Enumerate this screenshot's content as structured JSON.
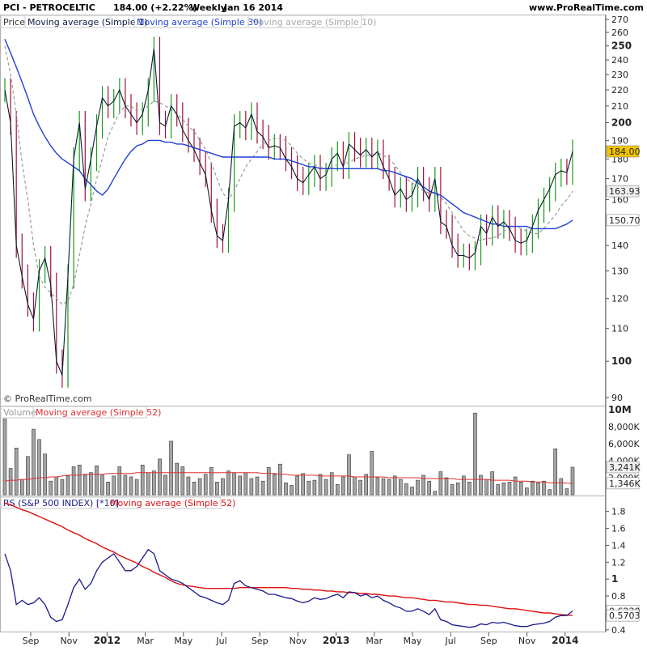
{
  "header": {
    "symbol_title": "PCI - PETROCELTIC",
    "last": "184.00 (+2.22%)",
    "period": "Weekly",
    "date": "Jan 16 2014",
    "site": "www.ProRealTime.com"
  },
  "watermark": "© ProRealTime.com",
  "colors": {
    "bull": "#1a9a1a",
    "bear": "#a0103a",
    "line": "#0a1a30",
    "ma30": "#1f3fd6",
    "ma10": "#9a9a9a",
    "volume_ma": "#e03030",
    "rs_line": "#1a1a8a",
    "rs_ma": "#e01010",
    "price_tag": "#f5c400"
  },
  "chart_data": [
    {
      "type": "line",
      "panel": "price",
      "legend": [
        "Price",
        "Moving average (Simple 1)",
        "Moving average (Simple 30)",
        "Moving average (Simple 10)"
      ],
      "y_scale": "log",
      "ylim": [
        90,
        270
      ],
      "y_ticks": [
        90,
        100,
        110,
        120,
        130,
        140,
        150,
        160,
        170,
        180,
        190,
        200,
        210,
        220,
        230,
        240,
        250,
        260,
        270
      ],
      "y_major_ticks": [
        100,
        150,
        200,
        250
      ],
      "x_ticks": [
        "Sep",
        "Nov",
        "2012",
        "Mar",
        "May",
        "Jul",
        "Sep",
        "Nov",
        "2013",
        "Mar",
        "May",
        "Jul",
        "Sep",
        "Nov",
        "2014"
      ],
      "x_major_ticks": [
        "2012",
        "2013",
        "2014"
      ],
      "price_tags": [
        {
          "label": "184.00",
          "value": 184,
          "series": "Price"
        },
        {
          "label": "163.93",
          "value": 163.93,
          "series": "Moving average (Simple 10)"
        },
        {
          "label": "150.70",
          "value": 150.7,
          "series": "Moving average (Simple 30)"
        }
      ],
      "close": [
        220,
        200,
        140,
        128,
        118,
        113,
        130,
        135,
        125,
        100,
        96,
        128,
        180,
        200,
        165,
        180,
        198,
        215,
        210,
        213,
        220,
        210,
        205,
        200,
        205,
        220,
        248,
        200,
        198,
        210,
        205,
        196,
        190,
        185,
        178,
        172,
        155,
        144,
        142,
        160,
        198,
        200,
        197,
        205,
        195,
        192,
        186,
        187,
        186,
        180,
        176,
        170,
        168,
        172,
        176,
        170,
        172,
        180,
        183,
        176,
        188,
        185,
        182,
        185,
        181,
        184,
        176,
        170,
        162,
        165,
        160,
        162,
        170,
        165,
        160,
        170,
        150,
        148,
        140,
        136,
        136,
        135,
        137,
        148,
        145,
        152,
        148,
        150,
        147,
        142,
        141,
        142,
        148,
        155,
        160,
        165,
        172,
        174,
        173,
        184
      ],
      "ma10": [
        250,
        230,
        205,
        178,
        160,
        140,
        128,
        124,
        122,
        120,
        118,
        119,
        125,
        136,
        148,
        158,
        170,
        180,
        192,
        199,
        206,
        210,
        210,
        207,
        208,
        210,
        213,
        212,
        210,
        208,
        205,
        202,
        198,
        195,
        190,
        185,
        178,
        170,
        163,
        160,
        164,
        170,
        176,
        180,
        184,
        188,
        190,
        191,
        191,
        190,
        187,
        183,
        180,
        178,
        177,
        176,
        175,
        176,
        177,
        178,
        178,
        180,
        181,
        182,
        182,
        183,
        182,
        180,
        177,
        173,
        170,
        168,
        166,
        164,
        163,
        163,
        161,
        158,
        154,
        150,
        146,
        144,
        143,
        142,
        143,
        143,
        144,
        146,
        147,
        148,
        147,
        146,
        145,
        145,
        147,
        150,
        153,
        157,
        160,
        163.93
      ],
      "ma30": [
        255,
        245,
        235,
        225,
        215,
        205,
        198,
        192,
        187,
        183,
        180,
        178,
        176,
        174,
        170,
        167,
        164,
        162,
        165,
        170,
        175,
        180,
        184,
        187,
        188,
        190,
        190,
        190,
        189,
        189,
        188,
        188,
        187,
        186,
        185,
        184,
        183,
        182,
        181,
        181,
        181,
        181,
        181,
        181,
        181,
        181,
        181,
        180,
        180,
        180,
        179,
        178,
        177,
        176,
        176,
        175,
        175,
        175,
        175,
        175,
        175,
        175,
        175,
        175,
        175,
        175,
        174,
        174,
        173,
        172,
        171,
        170,
        168,
        166,
        164,
        163,
        162,
        160,
        158,
        156,
        154,
        153,
        152,
        151,
        150,
        149,
        149,
        148,
        148,
        148,
        148,
        148,
        147,
        147,
        147,
        147,
        147,
        148,
        149,
        150.7
      ]
    },
    {
      "type": "bar",
      "panel": "volume",
      "legend": [
        "Volume",
        "Moving average (Simple 52)"
      ],
      "ylim": [
        0,
        10000000
      ],
      "y_ticks": [
        "10M",
        "8,000K",
        "6,000K",
        "4,000K",
        "2,000K"
      ],
      "tags": [
        {
          "label": "3,241K",
          "value": 3241000,
          "series": "Volume"
        },
        {
          "label": "1,346K",
          "value": 1346000,
          "series": "Moving average (Simple 52)"
        }
      ],
      "values": [
        8.9,
        3.1,
        5.5,
        1.8,
        4.5,
        7.7,
        6.5,
        4.8,
        1.6,
        2.1,
        1.8,
        2.2,
        3.3,
        3.5,
        2.3,
        2.6,
        3.4,
        2.3,
        1.5,
        2.2,
        3.3,
        2.3,
        2.1,
        1.8,
        3.5,
        2.6,
        2.8,
        4.2,
        2.3,
        6.3,
        3.7,
        3.3,
        2.1,
        1.5,
        1.9,
        2.4,
        3.2,
        1.5,
        1.9,
        2.8,
        2.6,
        2.2,
        2.6,
        1.9,
        2.1,
        1.6,
        3.2,
        2.4,
        3.6,
        1.4,
        1.1,
        2.2,
        2.5,
        1.6,
        1.7,
        2.4,
        1.8,
        2.6,
        1.2,
        2.1,
        4.7,
        2.1,
        1.7,
        2.4,
        5.1,
        2.0,
        1.9,
        1.8,
        2.2,
        1.8,
        1.3,
        0.9,
        1.7,
        2.3,
        1.6,
        0.4,
        2.7,
        2.0,
        1.2,
        1.4,
        2.2,
        1.5,
        9.6,
        2.3,
        1.8,
        2.7,
        1.2,
        1.4,
        1.5,
        2.1,
        1.5,
        0.8,
        1.6,
        1.4,
        1.6,
        0.6,
        5.4,
        1.9,
        0.7,
        3.241
      ],
      "ma52": [
        1.6,
        1.7,
        1.7,
        1.8,
        1.8,
        1.9,
        2.0,
        2.0,
        2.1,
        2.1,
        2.2,
        2.3,
        2.3,
        2.3,
        2.4,
        2.4,
        2.4,
        2.4,
        2.5,
        2.5,
        2.5,
        2.5,
        2.5,
        2.6,
        2.6,
        2.6,
        2.6,
        2.6,
        2.6,
        2.6,
        2.6,
        2.6,
        2.6,
        2.6,
        2.6,
        2.6,
        2.6,
        2.6,
        2.6,
        2.6,
        2.6,
        2.6,
        2.6,
        2.6,
        2.6,
        2.5,
        2.5,
        2.5,
        2.4,
        2.4,
        2.3,
        2.3,
        2.3,
        2.3,
        2.3,
        2.2,
        2.2,
        2.2,
        2.2,
        2.2,
        2.2,
        2.1,
        2.1,
        2.1,
        2.1,
        2.1,
        2.1,
        2.0,
        2.0,
        2.0,
        2.0,
        2.0,
        2.0,
        1.9,
        1.9,
        1.9,
        1.9,
        1.9,
        1.9,
        1.8,
        1.8,
        1.8,
        1.8,
        1.8,
        1.8,
        1.7,
        1.7,
        1.7,
        1.7,
        1.6,
        1.6,
        1.6,
        1.5,
        1.5,
        1.5,
        1.4,
        1.4,
        1.4,
        1.35,
        1.346
      ]
    },
    {
      "type": "line",
      "panel": "rs",
      "legend": [
        "RS (S&P 500 INDEX) [*10]",
        "Moving average (Simple 52)"
      ],
      "ylim": [
        0.38,
        1.95
      ],
      "y_ticks": [
        0.4,
        0.6,
        0.8,
        1,
        1.2,
        1.4,
        1.6,
        1.8
      ],
      "tags": [
        {
          "label": "0.6230",
          "value": 0.623,
          "series": "RS (S&P 500 INDEX) [*10]"
        },
        {
          "label": "0.5703",
          "value": 0.5703,
          "series": "Moving average (Simple 52)"
        }
      ],
      "rs": [
        1.3,
        1.1,
        0.7,
        0.75,
        0.7,
        0.72,
        0.78,
        0.7,
        0.55,
        0.5,
        0.52,
        0.7,
        0.9,
        1.0,
        0.88,
        0.95,
        1.1,
        1.2,
        1.25,
        1.3,
        1.2,
        1.1,
        1.1,
        1.15,
        1.25,
        1.35,
        1.3,
        1.1,
        1.05,
        1.0,
        0.98,
        0.95,
        0.9,
        0.85,
        0.8,
        0.78,
        0.75,
        0.72,
        0.7,
        0.75,
        0.95,
        0.98,
        0.92,
        0.9,
        0.88,
        0.86,
        0.82,
        0.82,
        0.8,
        0.78,
        0.77,
        0.74,
        0.72,
        0.74,
        0.78,
        0.76,
        0.77,
        0.8,
        0.82,
        0.78,
        0.85,
        0.84,
        0.8,
        0.82,
        0.78,
        0.8,
        0.75,
        0.72,
        0.68,
        0.66,
        0.62,
        0.62,
        0.65,
        0.62,
        0.58,
        0.65,
        0.52,
        0.5,
        0.46,
        0.45,
        0.44,
        0.43,
        0.44,
        0.47,
        0.46,
        0.49,
        0.48,
        0.49,
        0.47,
        0.45,
        0.44,
        0.44,
        0.46,
        0.47,
        0.48,
        0.5,
        0.55,
        0.57,
        0.57,
        0.623
      ],
      "ma52": [
        1.9,
        1.88,
        1.85,
        1.82,
        1.8,
        1.77,
        1.74,
        1.71,
        1.68,
        1.65,
        1.62,
        1.58,
        1.55,
        1.52,
        1.48,
        1.45,
        1.42,
        1.38,
        1.35,
        1.32,
        1.28,
        1.25,
        1.22,
        1.19,
        1.15,
        1.12,
        1.08,
        1.05,
        1.02,
        0.98,
        0.95,
        0.93,
        0.92,
        0.91,
        0.9,
        0.89,
        0.89,
        0.89,
        0.89,
        0.89,
        0.89,
        0.9,
        0.9,
        0.9,
        0.9,
        0.9,
        0.9,
        0.9,
        0.9,
        0.9,
        0.89,
        0.89,
        0.88,
        0.88,
        0.87,
        0.87,
        0.86,
        0.86,
        0.85,
        0.85,
        0.84,
        0.84,
        0.83,
        0.83,
        0.82,
        0.82,
        0.81,
        0.8,
        0.8,
        0.79,
        0.78,
        0.78,
        0.77,
        0.76,
        0.75,
        0.75,
        0.74,
        0.73,
        0.73,
        0.72,
        0.71,
        0.7,
        0.7,
        0.69,
        0.69,
        0.68,
        0.67,
        0.66,
        0.65,
        0.65,
        0.64,
        0.63,
        0.62,
        0.61,
        0.6,
        0.6,
        0.59,
        0.58,
        0.575,
        0.5703
      ]
    }
  ]
}
